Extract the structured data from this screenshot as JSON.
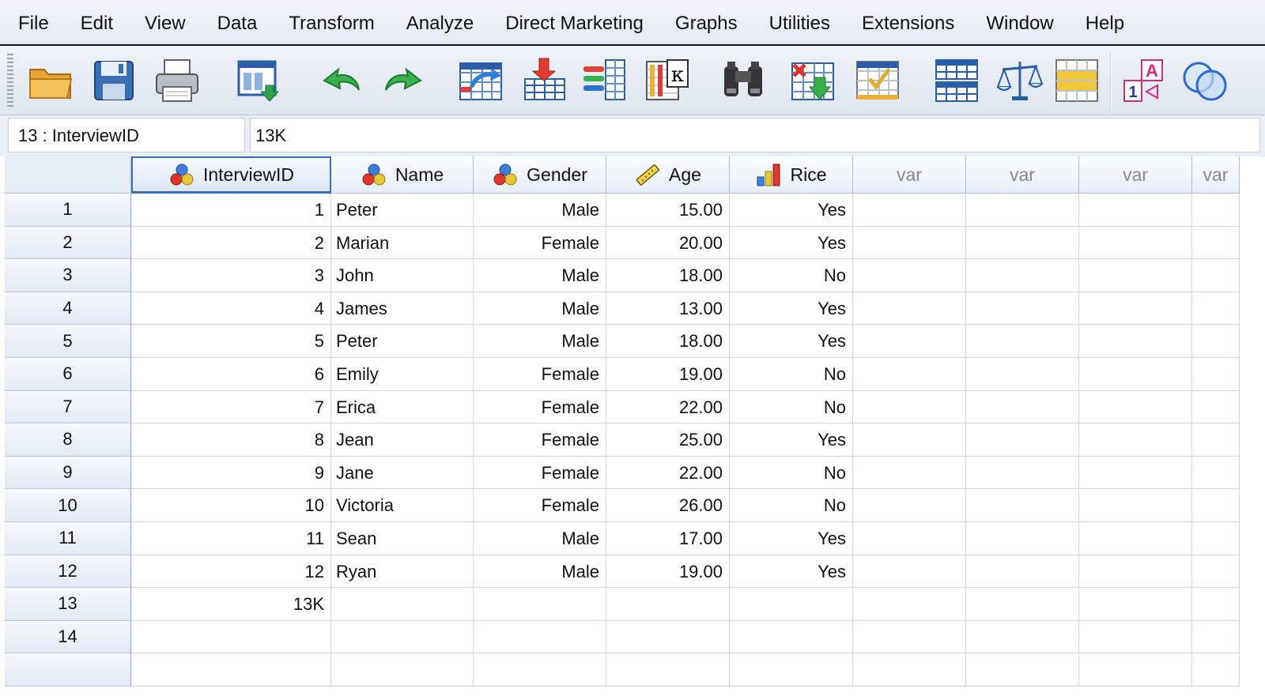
{
  "menu": [
    "File",
    "Edit",
    "View",
    "Data",
    "Transform",
    "Analyze",
    "Direct Marketing",
    "Graphs",
    "Utilities",
    "Extensions",
    "Window",
    "Help"
  ],
  "toolbar": [
    {
      "name": "open-data-icon"
    },
    {
      "name": "save-icon"
    },
    {
      "name": "print-icon"
    },
    {
      "name": "recall-dialog-icon"
    },
    {
      "name": "undo-icon"
    },
    {
      "name": "redo-icon"
    },
    {
      "name": "go-to-case-icon"
    },
    {
      "name": "go-to-variable-icon"
    },
    {
      "name": "variables-icon"
    },
    {
      "name": "run-descriptive-statistics-icon"
    },
    {
      "name": "find-icon"
    },
    {
      "name": "insert-cases-icon"
    },
    {
      "name": "insert-variable-icon"
    },
    {
      "name": "split-file-icon"
    },
    {
      "name": "weight-cases-icon"
    },
    {
      "name": "select-cases-icon"
    },
    {
      "name": "value-labels-icon"
    },
    {
      "name": "use-variable-sets-icon"
    }
  ],
  "cell_editor": {
    "reference": "13 : InterviewID",
    "value": "13K"
  },
  "columns": [
    {
      "label": "InterviewID",
      "icon": "nominal-icon",
      "align": "r",
      "selected": true
    },
    {
      "label": "Name",
      "icon": "nominal-icon",
      "align": "l"
    },
    {
      "label": "Gender",
      "icon": "nominal-icon",
      "align": "r"
    },
    {
      "label": "Age",
      "icon": "scale-icon",
      "align": "r"
    },
    {
      "label": "Rice",
      "icon": "ordinal-icon",
      "align": "r"
    },
    {
      "label": "var",
      "empty": true
    },
    {
      "label": "var",
      "empty": true
    },
    {
      "label": "var",
      "empty": true
    },
    {
      "label": "var",
      "empty": true
    }
  ],
  "rows": [
    {
      "n": "1",
      "cells": [
        "1",
        "Peter",
        "Male",
        "15.00",
        "Yes"
      ]
    },
    {
      "n": "2",
      "cells": [
        "2",
        "Marian",
        "Female",
        "20.00",
        "Yes"
      ]
    },
    {
      "n": "3",
      "cells": [
        "3",
        "John",
        "Male",
        "18.00",
        "No"
      ]
    },
    {
      "n": "4",
      "cells": [
        "4",
        "James",
        "Male",
        "13.00",
        "Yes"
      ]
    },
    {
      "n": "5",
      "cells": [
        "5",
        "Peter",
        "Male",
        "18.00",
        "Yes"
      ]
    },
    {
      "n": "6",
      "cells": [
        "6",
        "Emily",
        "Female",
        "19.00",
        "No"
      ]
    },
    {
      "n": "7",
      "cells": [
        "7",
        "Erica",
        "Female",
        "22.00",
        "No"
      ]
    },
    {
      "n": "8",
      "cells": [
        "8",
        "Jean",
        "Female",
        "25.00",
        "Yes"
      ]
    },
    {
      "n": "9",
      "cells": [
        "9",
        "Jane",
        "Female",
        "22.00",
        "No"
      ]
    },
    {
      "n": "10",
      "cells": [
        "10",
        "Victoria",
        "Female",
        "26.00",
        "No"
      ]
    },
    {
      "n": "11",
      "cells": [
        "11",
        "Sean",
        "Male",
        "17.00",
        "Yes"
      ]
    },
    {
      "n": "12",
      "cells": [
        "12",
        "Ryan",
        "Male",
        "19.00",
        "Yes"
      ]
    },
    {
      "n": "13",
      "cells": [
        "13K",
        "",
        "",
        "",
        ""
      ]
    },
    {
      "n": "14",
      "cells": [
        "",
        "",
        "",
        "",
        ""
      ]
    },
    {
      "n": "",
      "cells": [
        "",
        "",
        "",
        "",
        ""
      ]
    }
  ]
}
